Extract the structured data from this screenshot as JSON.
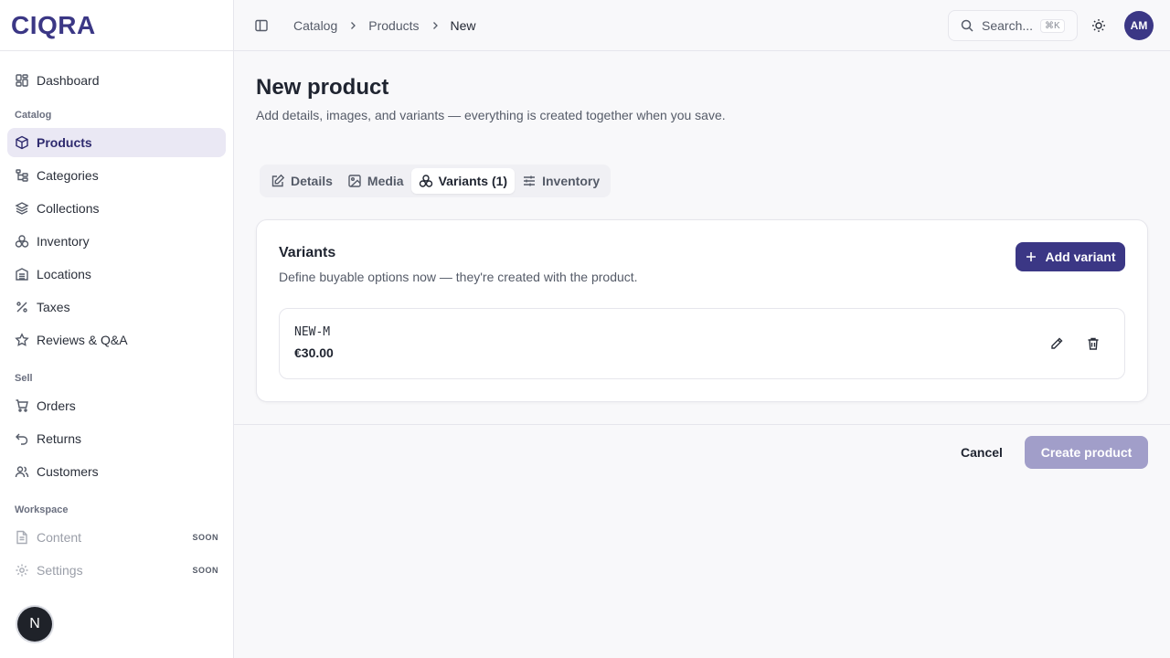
{
  "brand": {
    "name": "CIQRA",
    "color": "#3b3785"
  },
  "sidebar": {
    "top_items": [
      {
        "label": "Dashboard",
        "icon": "grid-icon"
      }
    ],
    "sections": [
      {
        "label": "Catalog",
        "items": [
          {
            "label": "Products",
            "icon": "box-icon",
            "active": true
          },
          {
            "label": "Categories",
            "icon": "tree-icon"
          },
          {
            "label": "Collections",
            "icon": "layers-icon"
          },
          {
            "label": "Inventory",
            "icon": "boxes-icon"
          },
          {
            "label": "Locations",
            "icon": "building-icon"
          },
          {
            "label": "Taxes",
            "icon": "percent-icon"
          },
          {
            "label": "Reviews & Q&A",
            "icon": "star-icon"
          }
        ]
      },
      {
        "label": "Sell",
        "items": [
          {
            "label": "Orders",
            "icon": "cart-icon"
          },
          {
            "label": "Returns",
            "icon": "return-icon"
          },
          {
            "label": "Customers",
            "icon": "users-icon"
          }
        ]
      },
      {
        "label": "Workspace",
        "items": [
          {
            "label": "Content",
            "icon": "file-icon",
            "badge": "SOON"
          },
          {
            "label": "Settings",
            "icon": "gear-icon",
            "badge": "SOON"
          }
        ]
      }
    ],
    "bottom_badge": "N"
  },
  "topbar": {
    "breadcrumbs": [
      "Catalog",
      "Products",
      "New"
    ],
    "search": {
      "placeholder": "Search...",
      "shortcut": "⌘K"
    },
    "avatar_initials": "AM"
  },
  "page": {
    "title": "New product",
    "subtitle": "Add details, images, and variants — everything is created together when you save.",
    "tabs": [
      {
        "label": "Details",
        "icon": "edit-icon"
      },
      {
        "label": "Media",
        "icon": "image-icon"
      },
      {
        "label": "Variants (1)",
        "icon": "variants-icon",
        "active": true
      },
      {
        "label": "Inventory",
        "icon": "sliders-icon"
      }
    ],
    "variants_card": {
      "title": "Variants",
      "subtitle": "Define buyable options now — they're created with the product.",
      "add_label": "Add variant",
      "items": [
        {
          "sku": "NEW-M",
          "price": "€30.00"
        }
      ]
    },
    "footer": {
      "cancel_label": "Cancel",
      "create_label": "Create product"
    }
  }
}
